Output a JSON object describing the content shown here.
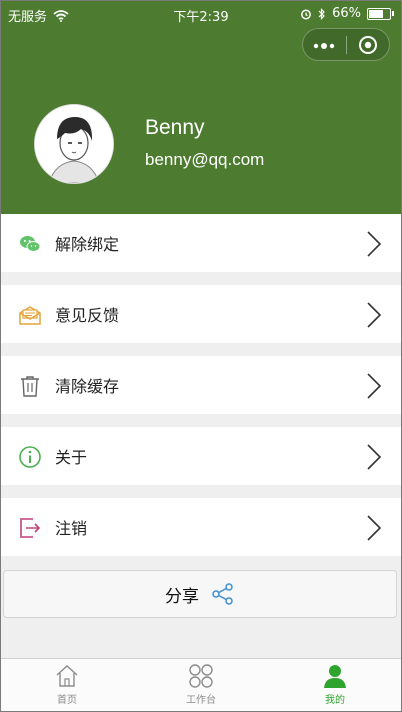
{
  "status_bar": {
    "carrier": "无服务",
    "time": "下午2:39",
    "battery": "66%"
  },
  "profile": {
    "name": "Benny",
    "email": "benny@qq.com"
  },
  "menu": [
    {
      "label": "解除绑定",
      "icon": "wechat-icon"
    },
    {
      "label": "意见反馈",
      "icon": "feedback-mail-icon"
    },
    {
      "label": "清除缓存",
      "icon": "trash-icon"
    },
    {
      "label": "关于",
      "icon": "info-icon"
    },
    {
      "label": "注销",
      "icon": "logout-icon"
    }
  ],
  "share": {
    "label": "分享",
    "icon": "share-icon"
  },
  "tabs": [
    {
      "label": "首页",
      "icon": "home-icon",
      "active": false
    },
    {
      "label": "工作台",
      "icon": "grid-icon",
      "active": false
    },
    {
      "label": "我的",
      "icon": "person-icon",
      "active": true
    }
  ],
  "colors": {
    "header_bg": "#4d7c31",
    "active_tab": "#2ea32e",
    "wechat_icon": "#62c36b",
    "feedback_icon": "#e6a43a",
    "info_icon": "#4caf50",
    "logout_icon": "#c2407a",
    "share_icon": "#3a8fd6"
  }
}
